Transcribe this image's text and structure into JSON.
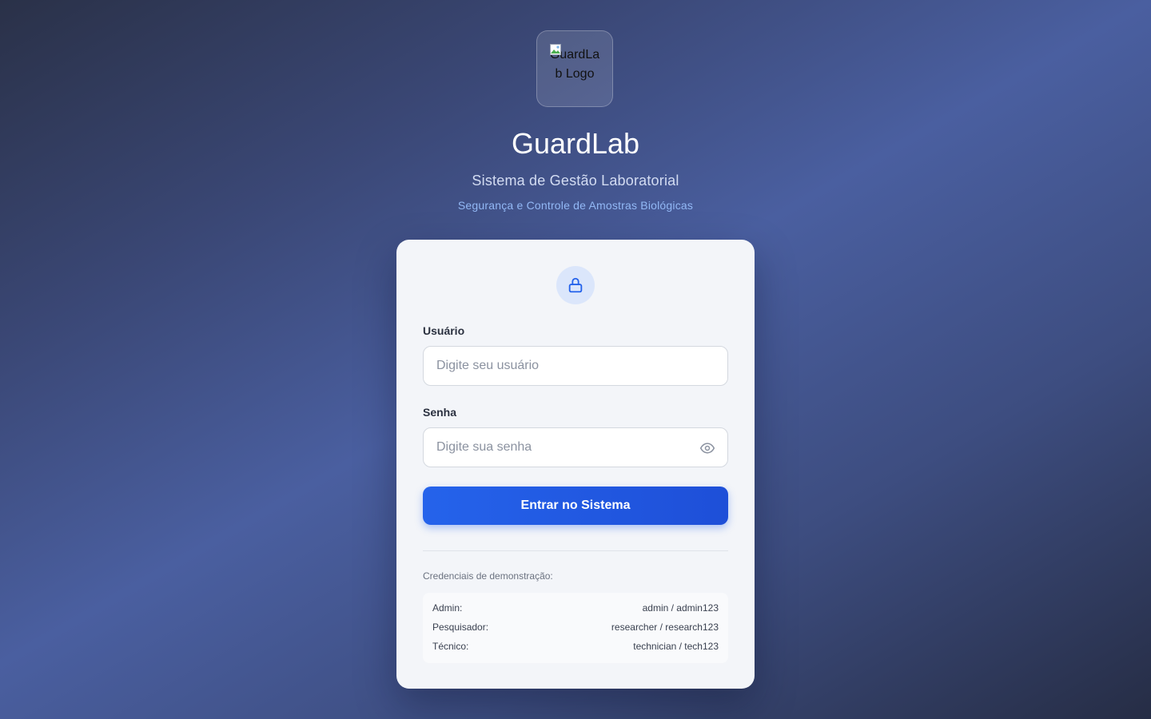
{
  "branding": {
    "logo_alt": "GuardLab Logo",
    "title": "GuardLab",
    "subtitle": "Sistema de Gestão Laboratorial",
    "tagline": "Segurança e Controle de Amostras Biológicas"
  },
  "login_form": {
    "header_icon": "lock-icon",
    "username": {
      "label": "Usuário",
      "placeholder": "Digite seu usuário",
      "value": ""
    },
    "password": {
      "label": "Senha",
      "placeholder": "Digite sua senha",
      "value": "",
      "toggle_icon": "eye-icon"
    },
    "submit_label": "Entrar no Sistema"
  },
  "demo_credentials": {
    "title": "Credenciais de demonstração:",
    "rows": [
      {
        "role": "Admin:",
        "credentials": "admin / admin123"
      },
      {
        "role": "Pesquisador:",
        "credentials": "researcher / research123"
      },
      {
        "role": "Técnico:",
        "credentials": "technician / tech123"
      }
    ]
  },
  "colors": {
    "accent": "#2563eb",
    "card_background": "#f3f5f9",
    "tagline": "#92b8f5"
  }
}
